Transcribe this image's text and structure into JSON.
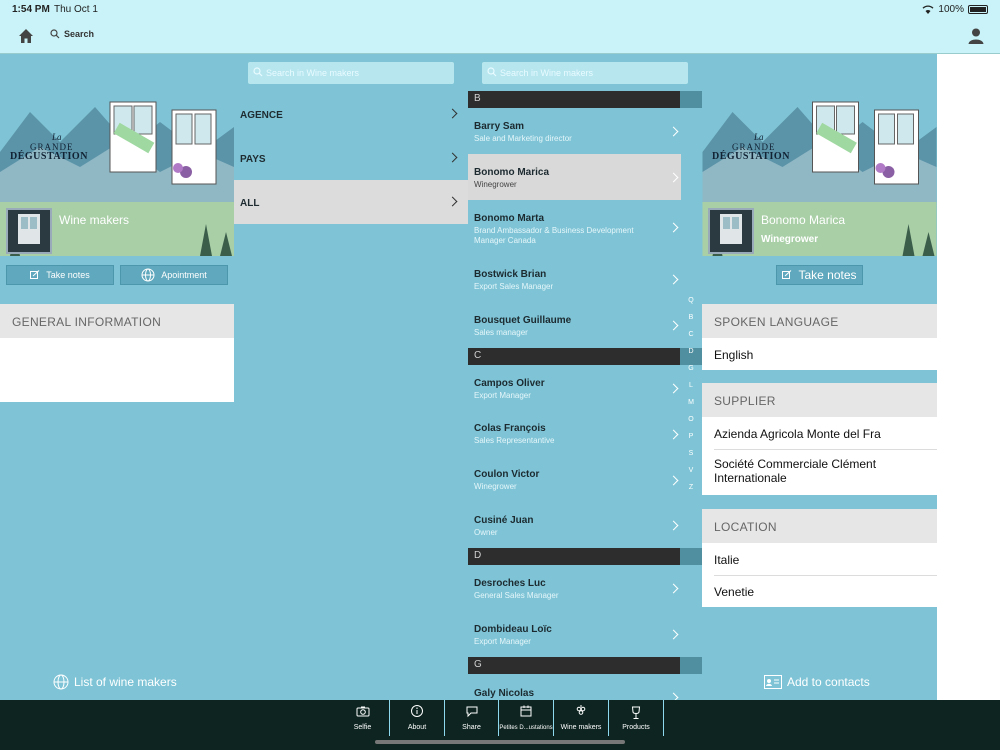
{
  "status": {
    "time": "1:54 PM",
    "date": "Thu Oct 1",
    "battery": "100%"
  },
  "nav": {
    "search_label": "Search"
  },
  "col1": {
    "title": "Wine makers",
    "take_notes": "Take notes",
    "appointment": "Apointment",
    "section_general": "GENERAL INFORMATION",
    "list_link": "List of wine makers"
  },
  "banner": {
    "line1": "La",
    "line2": "GRANDE",
    "line3": "DÉGUSTATION"
  },
  "col2": {
    "search_placeholder": "Search in Wine makers",
    "items": [
      {
        "label": "AGENCE"
      },
      {
        "label": "PAYS"
      },
      {
        "label": "ALL"
      }
    ]
  },
  "col3": {
    "search_placeholder": "Search in Wine makers",
    "groups": {
      "B": "B",
      "C": "C",
      "D": "D",
      "G": "G"
    },
    "rows": [
      {
        "name": "Barry Sam",
        "role": "Sale and Marketing director"
      },
      {
        "name": "Bonomo Marica",
        "role": "Winegrower"
      },
      {
        "name": "Bonomo Marta",
        "role": "Brand Ambassador & Business Development Manager Canada"
      },
      {
        "name": "Bostwick Brian",
        "role": "Export Sales Manager"
      },
      {
        "name": "Bousquet Guillaume",
        "role": "Sales manager"
      },
      {
        "name": "Campos Oliver",
        "role": "Export Manager"
      },
      {
        "name": "Colas François",
        "role": "Sales Representantive"
      },
      {
        "name": "Coulon Victor",
        "role": "Winegrower"
      },
      {
        "name": "Cusiné Juan",
        "role": "Owner"
      },
      {
        "name": "Desroches Luc",
        "role": "General Sales Manager"
      },
      {
        "name": "Dombideau Loïc",
        "role": "Export Manager"
      },
      {
        "name": "Galy Nicolas",
        "role": ""
      }
    ],
    "index": [
      "Q",
      "B",
      "C",
      "D",
      "G",
      "L",
      "M",
      "O",
      "P",
      "S",
      "V",
      "Z"
    ]
  },
  "col4": {
    "name": "Bonomo Marica",
    "role": "Winegrower",
    "take_notes": "Take notes",
    "spoken_hdr": "SPOKEN LANGUAGE",
    "spoken": "English",
    "supplier_hdr": "SUPPLIER",
    "supplier1": "Azienda Agricola Monte del Fra",
    "supplier2": "Société Commerciale Clément Internationale",
    "location_hdr": "LOCATION",
    "location1": "Italie",
    "location2": "Venetie",
    "add_contacts": "Add to contacts"
  },
  "tabs": [
    {
      "label": "Selfie",
      "icon": "camera-icon"
    },
    {
      "label": "About",
      "icon": "info-icon"
    },
    {
      "label": "Share",
      "icon": "chat-icon"
    },
    {
      "label": "Petites D...ustations",
      "icon": "calendar-icon"
    },
    {
      "label": "Wine makers",
      "icon": "grapes-icon"
    },
    {
      "label": "Products",
      "icon": "wine-glass-icon"
    }
  ]
}
